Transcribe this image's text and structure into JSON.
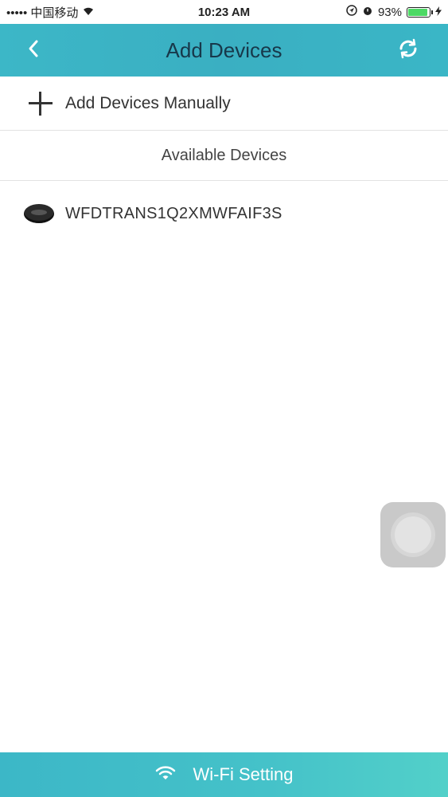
{
  "status_bar": {
    "carrier": "••••• 中国移动",
    "time": "10:23 AM",
    "battery": "93%",
    "battery_level": 0.93
  },
  "nav": {
    "title": "Add Devices"
  },
  "manual": {
    "label": "Add Devices Manually"
  },
  "section": {
    "title": "Available Devices"
  },
  "devices": [
    {
      "name": "WFDTRANS1Q2XMWFAIF3S"
    }
  ],
  "bottom": {
    "label": "Wi-Fi Setting"
  },
  "colors": {
    "accent": "#3ab6c6",
    "title_text": "#17384a",
    "battery_green": "#4cd964"
  }
}
